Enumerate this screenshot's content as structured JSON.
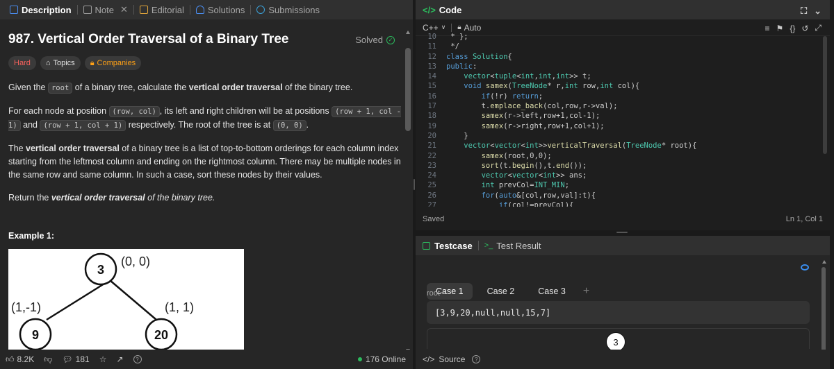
{
  "left_tabs": {
    "description": "Description",
    "note": "Note",
    "editorial": "Editorial",
    "solutions": "Solutions",
    "submissions": "Submissions"
  },
  "problem": {
    "title": "987. Vertical Order Traversal of a Binary Tree",
    "status": "Solved",
    "difficulty": "Hard",
    "topics_label": "Topics",
    "companies_label": "Companies",
    "p1_a": "Given the ",
    "p1_code": "root",
    "p1_b": " of a binary tree, calculate the ",
    "p1_bold": "vertical order traversal",
    "p1_c": " of the binary tree.",
    "p2_a": "For each node at position ",
    "p2_code1": "(row, col)",
    "p2_b": ", its left and right children will be at positions ",
    "p2_code2": "(row + 1, col - 1)",
    "p2_c": " and ",
    "p2_code3": "(row + 1, col + 1)",
    "p2_d": " respectively. The root of the tree is at ",
    "p2_code4": "(0, 0)",
    "p2_e": ".",
    "p3_a": "The ",
    "p3_bold": "vertical order traversal",
    "p3_b": " of a binary tree is a list of top-to-bottom orderings for each column index starting from the leftmost column and ending on the rightmost column. There may be multiple nodes in the same row and same column. In such a case, sort these nodes by their values.",
    "p4_a": "Return the ",
    "p4_bold": "vertical order traversal",
    "p4_b": " of the binary tree.",
    "example_title": "Example 1:",
    "tree": {
      "root_val": "3",
      "root_coord": "(0, 0)",
      "left_val": "9",
      "left_coord": "(1,-1)",
      "right_val": "20",
      "right_coord": "(1, 1)"
    }
  },
  "footer": {
    "likes": "8.2K",
    "comments": "181",
    "online": "176 Online"
  },
  "code_panel": {
    "title": "Code",
    "language": "C++",
    "mode": "Auto",
    "status": "Saved",
    "cursor": "Ln 1, Col 1",
    "lines": [
      {
        "n": "10",
        "t": " * };"
      },
      {
        "n": "11",
        "t": " */"
      },
      {
        "n": "12",
        "t": "class Solution{"
      },
      {
        "n": "13",
        "t": "public:"
      },
      {
        "n": "14",
        "t": "    vector<tuple<int,int,int>> t;"
      },
      {
        "n": "15",
        "t": "    void samex(TreeNode* r,int row,int col){"
      },
      {
        "n": "16",
        "t": "        if(!r) return;"
      },
      {
        "n": "17",
        "t": "        t.emplace_back(col,row,r->val);"
      },
      {
        "n": "18",
        "t": "        samex(r->left,row+1,col-1);"
      },
      {
        "n": "19",
        "t": "        samex(r->right,row+1,col+1);"
      },
      {
        "n": "20",
        "t": "    }"
      },
      {
        "n": "21",
        "t": "    vector<vector<int>>verticalTraversal(TreeNode* root){"
      },
      {
        "n": "22",
        "t": "        samex(root,0,0);"
      },
      {
        "n": "23",
        "t": "        sort(t.begin(),t.end());"
      },
      {
        "n": "24",
        "t": "        vector<vector<int>> ans;"
      },
      {
        "n": "25",
        "t": "        int prevCol=INT_MIN;"
      },
      {
        "n": "26",
        "t": "        for(auto&[col,row,val]:t){"
      },
      {
        "n": "27",
        "t": "            if(col!=prevCol){"
      }
    ]
  },
  "test_panel": {
    "testcase_tab": "Testcase",
    "result_tab": "Test Result",
    "cases": [
      "Case 1",
      "Case 2",
      "Case 3"
    ],
    "plus": "+",
    "root_label": "root =",
    "root_value": "[3,9,20,null,null,15,7]"
  },
  "badge": "3",
  "bottom": {
    "source": "Source"
  }
}
